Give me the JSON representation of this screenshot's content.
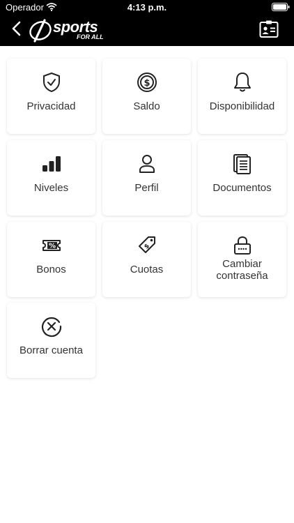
{
  "status_bar": {
    "carrier": "Operador",
    "time": "4:13 p.m."
  },
  "header": {
    "logo_text": "sports",
    "logo_tagline": "FOR ALL",
    "back_icon": "chevron-left-icon",
    "action_icon": "id-card-icon"
  },
  "colors": {
    "header_bg": "#000000",
    "tile_bg": "#ffffff",
    "label": "#333333"
  },
  "menu": [
    {
      "label": "Privacidad",
      "icon": "shield-check-icon"
    },
    {
      "label": "Saldo",
      "icon": "dollar-coin-icon"
    },
    {
      "label": "Disponibilidad",
      "icon": "bell-icon"
    },
    {
      "label": "Niveles",
      "icon": "bar-levels-icon"
    },
    {
      "label": "Perfil",
      "icon": "user-icon"
    },
    {
      "label": "Documentos",
      "icon": "documents-icon"
    },
    {
      "label": "Bonos",
      "icon": "percent-ticket-icon"
    },
    {
      "label": "Cuotas",
      "icon": "price-tag-icon"
    },
    {
      "label": "Cambiar contraseña",
      "icon": "lock-icon"
    },
    {
      "label": "Borrar cuenta",
      "icon": "delete-circle-icon"
    }
  ]
}
